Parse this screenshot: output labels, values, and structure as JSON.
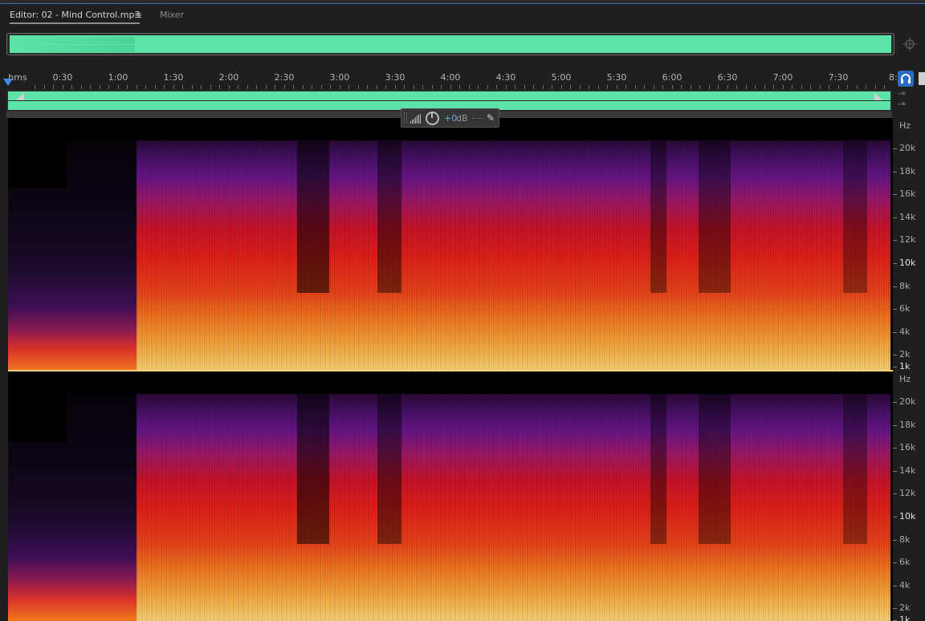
{
  "tabs": {
    "editor": "Editor: 02 - Mind Control.mp3",
    "menu_glyph": "≡",
    "mixer": "Mixer"
  },
  "ruler": {
    "unit": "hms",
    "labels": [
      "0:30",
      "1:00",
      "1:30",
      "2:00",
      "2:30",
      "3:00",
      "3:30",
      "4:00",
      "4:30",
      "5:00",
      "5:30",
      "6:00",
      "6:30",
      "7:00",
      "7:30",
      "8:"
    ]
  },
  "channel_levels": [
    "-∞",
    "-∞"
  ],
  "hud": {
    "value": "+0",
    "unit": "dB"
  },
  "frequency_axis": {
    "unit": "Hz",
    "labels": [
      "20k",
      "18k",
      "16k",
      "14k",
      "12k",
      "10k",
      "8k",
      "6k",
      "4k",
      "2k",
      "1k"
    ]
  },
  "icons": [
    "zoom-icon",
    "headphones-icon",
    "pin-icon",
    "level-bars-icon",
    "knob-icon",
    "thumbtack-icon",
    "menu-icon"
  ],
  "colors": {
    "waveform": "#5de3a8",
    "accent": "#3d8ee6",
    "hud_value": "#5aa9ff"
  }
}
